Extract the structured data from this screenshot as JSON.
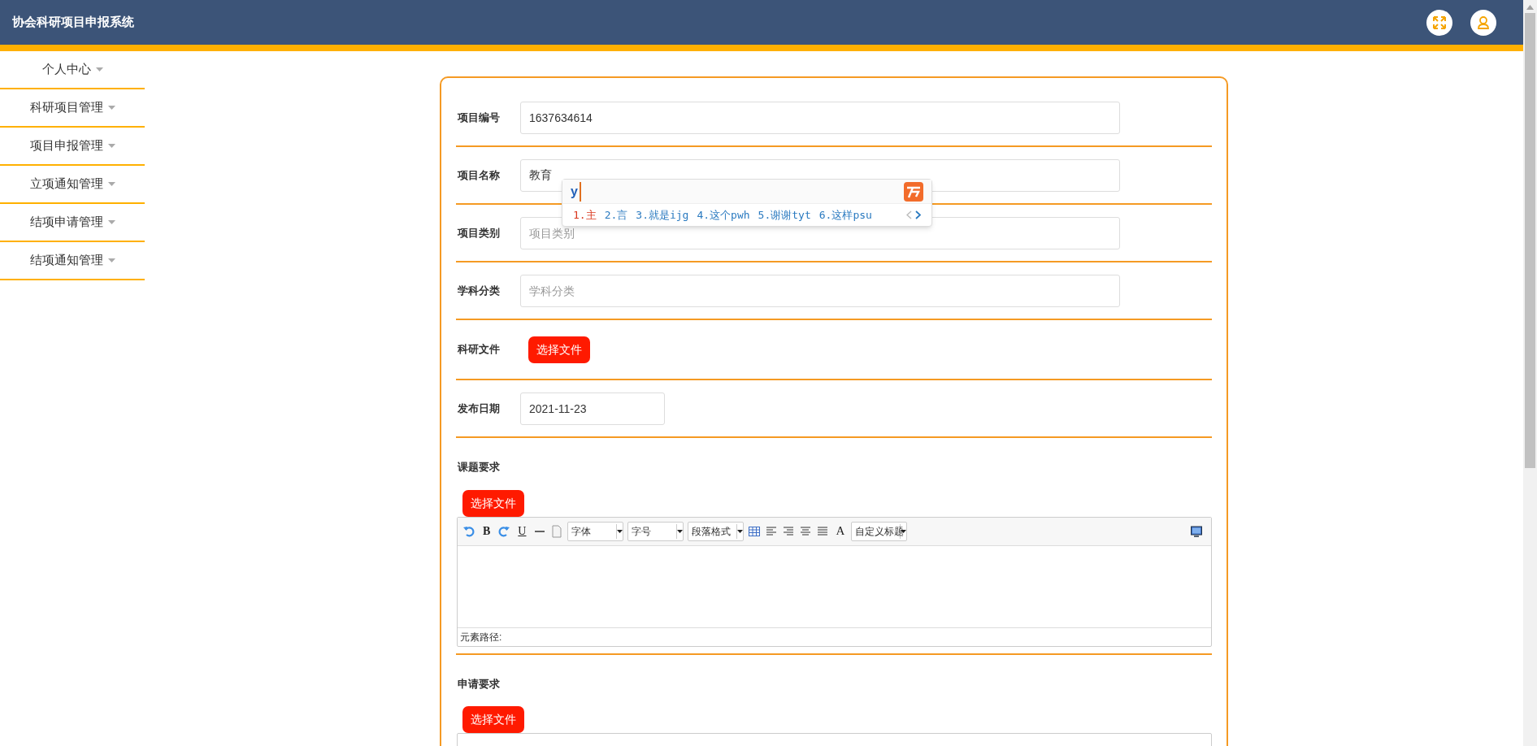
{
  "header": {
    "title": "协会科研项目申报系统"
  },
  "sidebar": {
    "items": [
      {
        "label": "个人中心"
      },
      {
        "label": "科研项目管理"
      },
      {
        "label": "项目申报管理"
      },
      {
        "label": "立项通知管理"
      },
      {
        "label": "结项申请管理"
      },
      {
        "label": "结项通知管理"
      }
    ]
  },
  "form": {
    "fields": [
      {
        "kind": "input",
        "label": "项目编号",
        "value": "1637634614"
      },
      {
        "kind": "input",
        "label": "项目名称",
        "value": "教育"
      },
      {
        "kind": "input",
        "label": "项目类别",
        "placeholder": "项目类别"
      },
      {
        "kind": "input",
        "label": "学科分类",
        "placeholder": "学科分类"
      },
      {
        "kind": "file",
        "label": "科研文件",
        "button": "选择文件"
      },
      {
        "kind": "date",
        "label": "发布日期",
        "value": "2021-11-23"
      },
      {
        "kind": "editor",
        "label": "课题要求",
        "button": "选择文件",
        "status": "元素路径:",
        "tools": [
          {
            "kind": "undo"
          },
          {
            "kind": "bold",
            "text": "B"
          },
          {
            "kind": "redo"
          },
          {
            "kind": "underline",
            "text": "U"
          },
          {
            "kind": "hr"
          },
          {
            "kind": "page"
          },
          {
            "kind": "select",
            "text": "字体"
          },
          {
            "kind": "select",
            "text": "字号"
          },
          {
            "kind": "select",
            "text": "段落格式"
          },
          {
            "kind": "table"
          },
          {
            "kind": "alignleft"
          },
          {
            "kind": "alignright"
          },
          {
            "kind": "center"
          },
          {
            "kind": "justify"
          },
          {
            "kind": "fontcolor",
            "text": "A"
          },
          {
            "kind": "select",
            "text": "自定义标题"
          },
          {
            "kind": "preview"
          }
        ]
      },
      {
        "kind": "editor",
        "label": "申请要求",
        "button": "选择文件"
      }
    ]
  },
  "ime": {
    "composition": "y",
    "candidates": [
      {
        "text": "1.主",
        "selected": true
      },
      {
        "text": "2.言",
        "selected": false
      },
      {
        "text": "3.就是ijg",
        "selected": false
      },
      {
        "text": "4.这个pwh",
        "selected": false
      },
      {
        "text": "5.谢谢tyt",
        "selected": false
      },
      {
        "text": "6.这样psu",
        "selected": false
      }
    ]
  }
}
